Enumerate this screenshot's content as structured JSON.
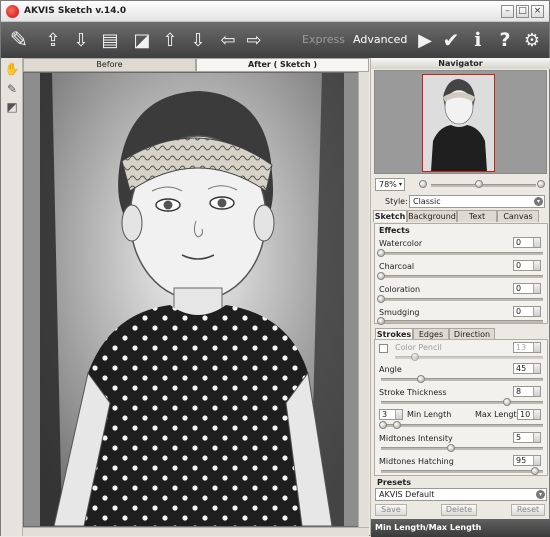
{
  "window": {
    "title": "AKVIS Sketch v.14.0"
  },
  "toolbar": {
    "express": "Express",
    "advanced": "Advanced"
  },
  "view_tabs": {
    "before": "Before",
    "after": "After ( Sketch )"
  },
  "navigator": {
    "title": "Navigator",
    "zoom": "78%"
  },
  "style": {
    "label": "Style:",
    "value": "Classic"
  },
  "settings_tabs": [
    "Sketch",
    "Background",
    "Text",
    "Canvas"
  ],
  "effects": {
    "title": "Effects",
    "items": [
      {
        "label": "Watercolor",
        "value": "0"
      },
      {
        "label": "Charcoal",
        "value": "0"
      },
      {
        "label": "Coloration",
        "value": "0"
      },
      {
        "label": "Smudging",
        "value": "0"
      }
    ]
  },
  "strokes": {
    "tabs": [
      "Strokes",
      "Edges",
      "Direction"
    ],
    "color_pencil": {
      "label": "Color Pencil",
      "value": "13"
    },
    "angle": {
      "label": "Angle",
      "value": "45"
    },
    "thickness": {
      "label": "Stroke Thickness",
      "value": "8"
    },
    "min_length": {
      "label": "Min Length",
      "value": "3"
    },
    "max_length": {
      "label": "Max Length",
      "value": "10"
    },
    "midtones_intensity": {
      "label": "Midtones Intensity",
      "value": "5"
    },
    "midtones_hatching": {
      "label": "Midtones Hatching",
      "value": "95"
    }
  },
  "presets": {
    "title": "Presets",
    "value": "AKVIS Default",
    "save": "Save",
    "delete": "Delete",
    "reset": "Reset"
  },
  "status": {
    "hint": "Min Length/Max Length"
  }
}
